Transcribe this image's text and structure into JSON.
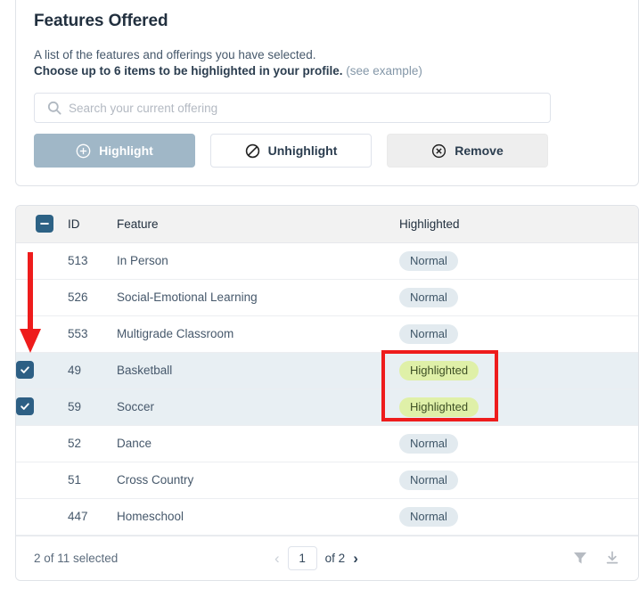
{
  "header": {
    "title": "Features Offered",
    "description_line1": "A list of the features and offerings you have selected.",
    "description_line2": "Choose up to 6 items to be highlighted in your profile.",
    "see_example_link": "(see example)"
  },
  "search": {
    "placeholder": "Search your current offering",
    "value": "",
    "icon": "search-icon"
  },
  "actions": {
    "highlight": {
      "label": "Highlight",
      "icon": "plus-circle-icon",
      "state": "disabled",
      "bg": "#a0b7c7",
      "fg": "#ffffff"
    },
    "unhighlight": {
      "label": "Unhighlight",
      "icon": "no-entry-icon",
      "state": "enabled",
      "bg": "#ffffff",
      "fg": "#2b3d4f"
    },
    "remove": {
      "label": "Remove",
      "icon": "x-circle-icon",
      "state": "enabled",
      "bg": "#eeeeee",
      "fg": "#2b3d4f"
    }
  },
  "table": {
    "select_all": {
      "state": "indeterminate",
      "icon": "checkbox-indeterminate-icon"
    },
    "columns": {
      "id": "ID",
      "feature": "Feature",
      "highlighted": "Highlighted"
    },
    "rows": [
      {
        "selected": false,
        "id": "513",
        "feature": "In Person",
        "status": "Normal",
        "status_kind": "normal"
      },
      {
        "selected": false,
        "id": "526",
        "feature": "Social-Emotional Learning",
        "status": "Normal",
        "status_kind": "normal"
      },
      {
        "selected": false,
        "id": "553",
        "feature": "Multigrade Classroom",
        "status": "Normal",
        "status_kind": "normal"
      },
      {
        "selected": true,
        "id": "49",
        "feature": "Basketball",
        "status": "Highlighted",
        "status_kind": "highlighted"
      },
      {
        "selected": true,
        "id": "59",
        "feature": "Soccer",
        "status": "Highlighted",
        "status_kind": "highlighted"
      },
      {
        "selected": false,
        "id": "52",
        "feature": "Dance",
        "status": "Normal",
        "status_kind": "normal"
      },
      {
        "selected": false,
        "id": "51",
        "feature": "Cross Country",
        "status": "Normal",
        "status_kind": "normal"
      },
      {
        "selected": false,
        "id": "447",
        "feature": "Homeschool",
        "status": "Normal",
        "status_kind": "normal"
      }
    ]
  },
  "footer": {
    "selection_summary": "2 of 11 selected",
    "prev_label": "‹",
    "page_value": "1",
    "of_label": "of 2",
    "next_label": "›",
    "filter_icon": "filter-icon",
    "download_icon": "download-icon"
  },
  "annotations": {
    "arrow_color": "#ee1c1c",
    "box_color": "#ee1c1c",
    "arrow_target": "row-checkbox-basketball",
    "box_target": "highlighted-status-badges"
  },
  "colors": {
    "badge_normal_bg": "#e2eaef",
    "badge_highlighted_bg": "#dff0a8",
    "checkbox_bg": "#2d5f84",
    "selected_row_bg": "#e8eff3",
    "header_bg": "#f2f2f2"
  }
}
